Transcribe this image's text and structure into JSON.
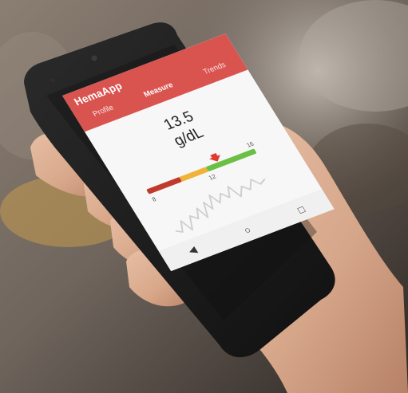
{
  "app": {
    "title": "HemaApp",
    "tabs": [
      {
        "label": "Profile"
      },
      {
        "label": "Measure"
      },
      {
        "label": "Trends"
      }
    ]
  },
  "reading": {
    "value": "13.5",
    "unit": "g/dL"
  },
  "scale": {
    "ticks": [
      "8",
      "12",
      "16"
    ],
    "colors": {
      "low": "#c0392b",
      "mid": "#f0b33a",
      "high": "#6abf45",
      "marker": "#e23b2e",
      "bar": "#d9534f"
    }
  },
  "navbar": {
    "back_icon": "back-triangle-icon",
    "home_icon": "home-circle-icon",
    "recents_icon": "recents-square-icon"
  }
}
